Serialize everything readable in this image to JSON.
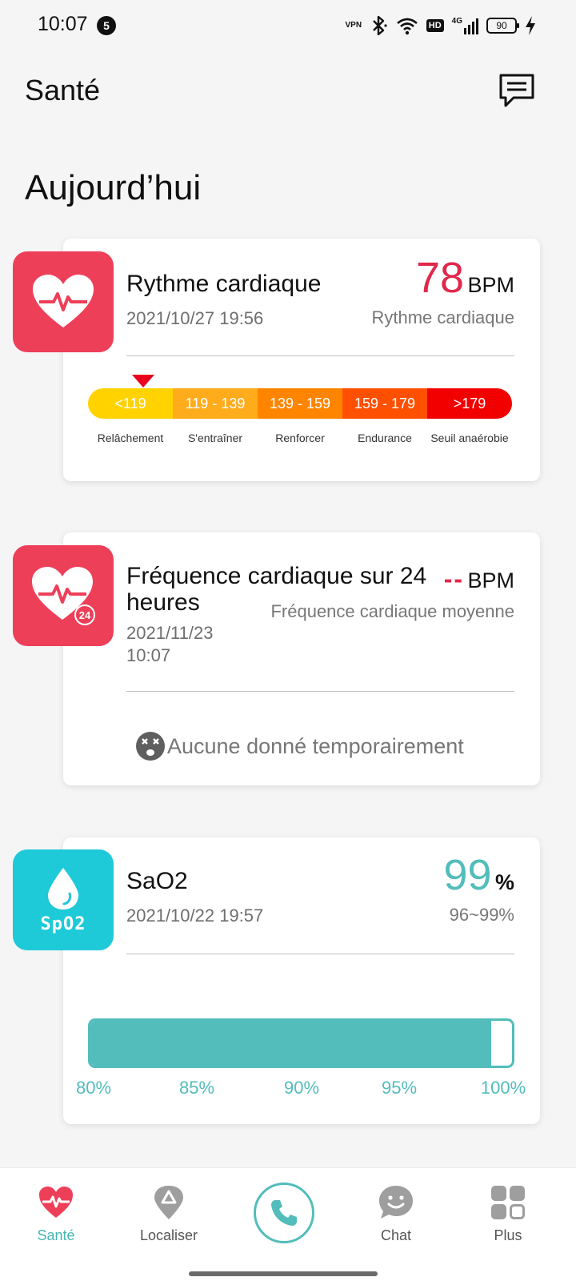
{
  "status_bar": {
    "time": "10:07",
    "notification_count": "5",
    "vpn_label": "VPN",
    "hd_label": "HD",
    "network_label": "4G",
    "battery_level": "90"
  },
  "header": {
    "title": "Santé"
  },
  "section": {
    "title": "Aujourd’hui"
  },
  "heart_rate_card": {
    "title": "Rythme cardiaque",
    "date": "2021/10/27 19:56",
    "value": "78",
    "unit": "BPM",
    "subtitle": "Rythme cardiaque",
    "zones": [
      {
        "range": "<119",
        "label": "Relâchement",
        "color": "#ffd200"
      },
      {
        "range": "119 - 139",
        "label": "S'entraîner",
        "color": "#ffac1c"
      },
      {
        "range": "139 - 159",
        "label": "Renforcer",
        "color": "#ff8500"
      },
      {
        "range": "159 - 179",
        "label": "Endurance",
        "color": "#ff4f00"
      },
      {
        "range": ">179",
        "label": "Seuil anaérobie",
        "color": "#f20000"
      }
    ],
    "value_color": "#e0284c",
    "marker_color": "#e8001c"
  },
  "hr24_card": {
    "title_line1": "Fréquence cardiaque sur 24",
    "title_line2": "heures",
    "date_line1": "2021/11/23",
    "date_line2": "10:07",
    "value": "--",
    "unit": "BPM",
    "subtitle": "Fréquence cardiaque moyenne",
    "badge": "24",
    "no_data_text": "Aucune donné temporairement"
  },
  "spo2_card": {
    "title": "SaO2",
    "date": "2021/10/22 19:57",
    "value": "99",
    "unit": "%",
    "range": "96~99%",
    "tile_label": "SpO2",
    "bar_fill_fraction": 0.95,
    "ticks": [
      "80%",
      "85%",
      "90%",
      "95%",
      "100%"
    ],
    "accent_color": "#52bdbb"
  },
  "bottom_nav": {
    "items": [
      {
        "label": "Santé",
        "icon": "heart-pulse-icon",
        "active": true
      },
      {
        "label": "Localiser",
        "icon": "location-pin-icon",
        "active": false
      },
      {
        "label": "",
        "icon": "phone-icon",
        "active": false
      },
      {
        "label": "Chat",
        "icon": "chat-smile-icon",
        "active": false
      },
      {
        "label": "Plus",
        "icon": "grid-icon",
        "active": false
      }
    ]
  },
  "colors": {
    "brand_red": "#ee3f59",
    "brand_cyan": "#1ec9d8",
    "teal": "#44b6b4"
  }
}
